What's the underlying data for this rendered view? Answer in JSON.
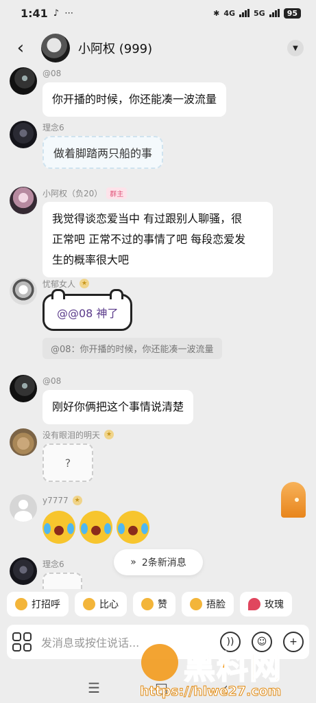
{
  "status_bar": {
    "time": "1:41",
    "left_icons": "♪ ⋯",
    "network": "4G",
    "network2": "5G",
    "battery": "95"
  },
  "header": {
    "title": "小阿权 (999)"
  },
  "messages": [
    {
      "sender": "@08",
      "text": "你开播的时候，你还能凑一波流量"
    },
    {
      "sender": "理念6",
      "sticker_text": "做着脚踏两只船的事"
    },
    {
      "sender": "小阿权（负20）",
      "role_badge": "群主",
      "text_lines": [
        "我觉得谈恋爱当中 有过跟别人聊骚，很",
        "正常吧 正常不过的事情了吧 每段恋爱发",
        "生的概率很大吧"
      ]
    },
    {
      "sender": "忧郁女人",
      "sticker_text": "@@08 神了",
      "quote": "@08：你开播的时候，你还能凑一波流量"
    },
    {
      "sender": "@08",
      "text": "刚好你俩把这个事情说清楚"
    },
    {
      "sender": "没有眼泪的明天",
      "sticker_text": "?"
    },
    {
      "sender": "y7777"
    },
    {
      "sender": "理念6"
    }
  ],
  "new_messages": {
    "label": "2条新消息"
  },
  "quick_replies": [
    "打招呼",
    "比心",
    "赞",
    "捂脸",
    "玫瑰"
  ],
  "input": {
    "placeholder": "发消息或按住说话..."
  },
  "watermark": {
    "text": "黑料网",
    "url": "https://hlwe27.com"
  },
  "icons": {
    "back": "back-arrow-icon",
    "menu": "chevron-down-icon",
    "apps": "apps-grid-icon",
    "voice": "voice-icon",
    "emoji": "emoji-icon",
    "add": "plus-icon"
  },
  "colors": {
    "background": "#ededed",
    "bubble": "#ffffff",
    "owner_badge": "#e0557a",
    "watermark": "#f29a1c"
  }
}
